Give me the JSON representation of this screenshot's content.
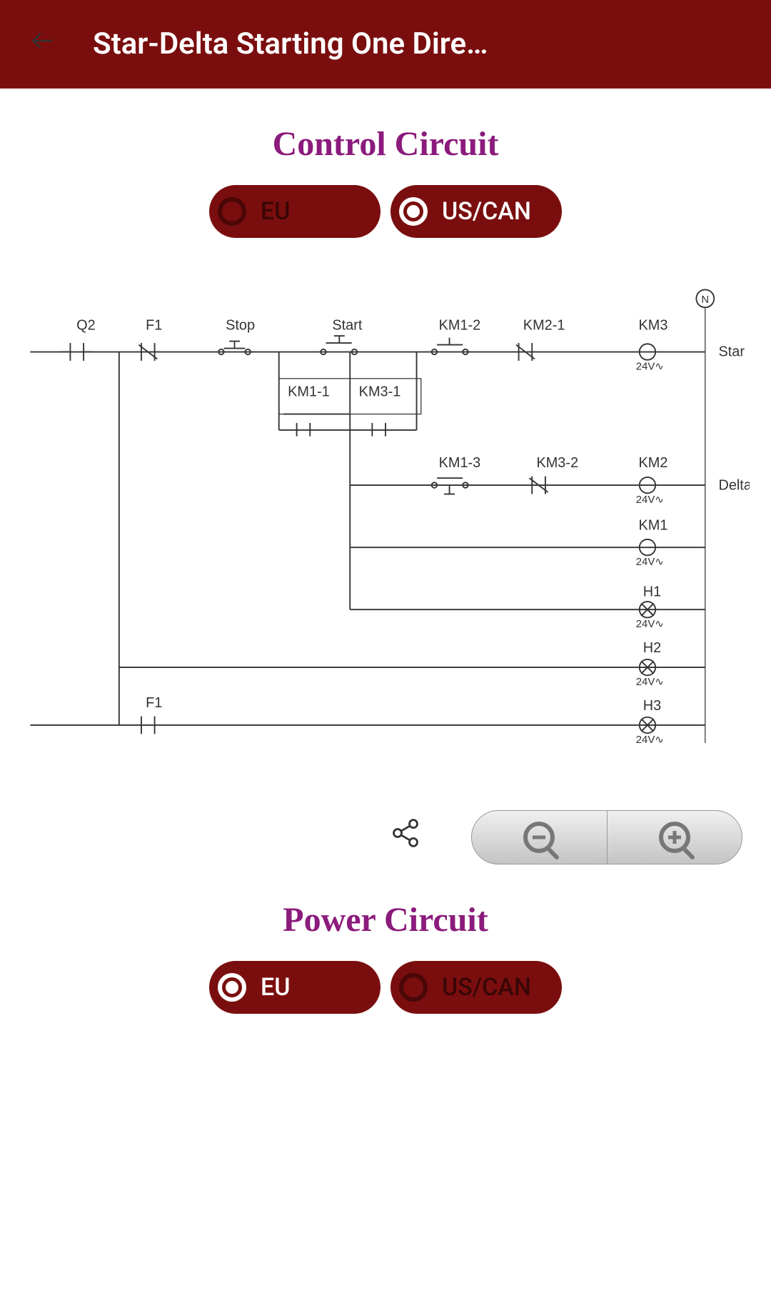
{
  "header": {
    "title": "Star-Delta Starting One Dire…"
  },
  "sections": {
    "control": {
      "title": "Control Circuit",
      "toggles": {
        "eu": "EU",
        "us": "US/CAN"
      },
      "selected": "us"
    },
    "power": {
      "title": "Power Circuit",
      "toggles": {
        "eu": "EU",
        "us": "US/CAN"
      },
      "selected": "eu"
    }
  },
  "diagram": {
    "labels": {
      "Q2": "Q2",
      "F1": "F1",
      "Stop": "Stop",
      "Start": "Start",
      "KM1_1": "KM1-1",
      "KM1_2": "KM1-2",
      "KM1_3": "KM1-3",
      "KM2": "KM2",
      "KM2_1": "KM2-1",
      "KM3": "KM3",
      "KM3_1": "KM3-1",
      "KM3_2": "KM3-2",
      "KM1": "KM1",
      "H1": "H1",
      "H2": "H2",
      "H3": "H3",
      "Star": "Star",
      "Delta": "Delta",
      "N": "N",
      "volt": "24V∿"
    }
  }
}
